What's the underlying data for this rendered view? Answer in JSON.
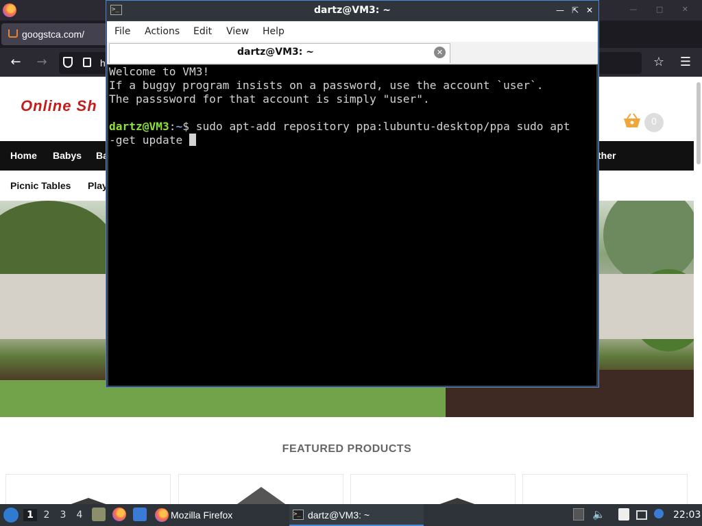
{
  "firefox": {
    "tab_title": "googstca.com/",
    "url_prefix": "h",
    "site": {
      "logo_text": "Online Sh",
      "cart_count": "0",
      "nav_row1": [
        "Home",
        "Babys",
        "Ba",
        "ther"
      ],
      "nav_row2": [
        "Picnic Tables",
        "Play"
      ],
      "featured_title": "FEATURED PRODUCTS"
    }
  },
  "terminal": {
    "window_title": "dartz@VM3: ~",
    "menu": [
      "File",
      "Actions",
      "Edit",
      "View",
      "Help"
    ],
    "tab_label": "dartz@VM3: ~",
    "lines": {
      "l1": "Welcome to VM3!",
      "l2": "If a buggy program insists on a password, use the account `user`.",
      "l3": "The passsword for that account is simply \"user\"."
    },
    "prompt": {
      "user_host": "dartz@VM3",
      "sep": ":",
      "path": "~",
      "dollar": "$ ",
      "command_line1": "sudo apt-add repository ppa:lubuntu-desktop/ppa sudo apt",
      "command_line2": "-get update "
    }
  },
  "taskbar": {
    "workspaces": [
      "1",
      "2",
      "3",
      "4"
    ],
    "tasks": [
      "Mozilla Firefox",
      "dartz@VM3: ~"
    ],
    "clock": "22:03"
  },
  "colors": {
    "accent": "#4a8ad8",
    "prompt_user": "#8ae234",
    "prompt_path": "#729fcf",
    "terminal_bg": "#000000",
    "terminal_fg": "#d3d3d3",
    "site_logo": "#c21d1d"
  }
}
